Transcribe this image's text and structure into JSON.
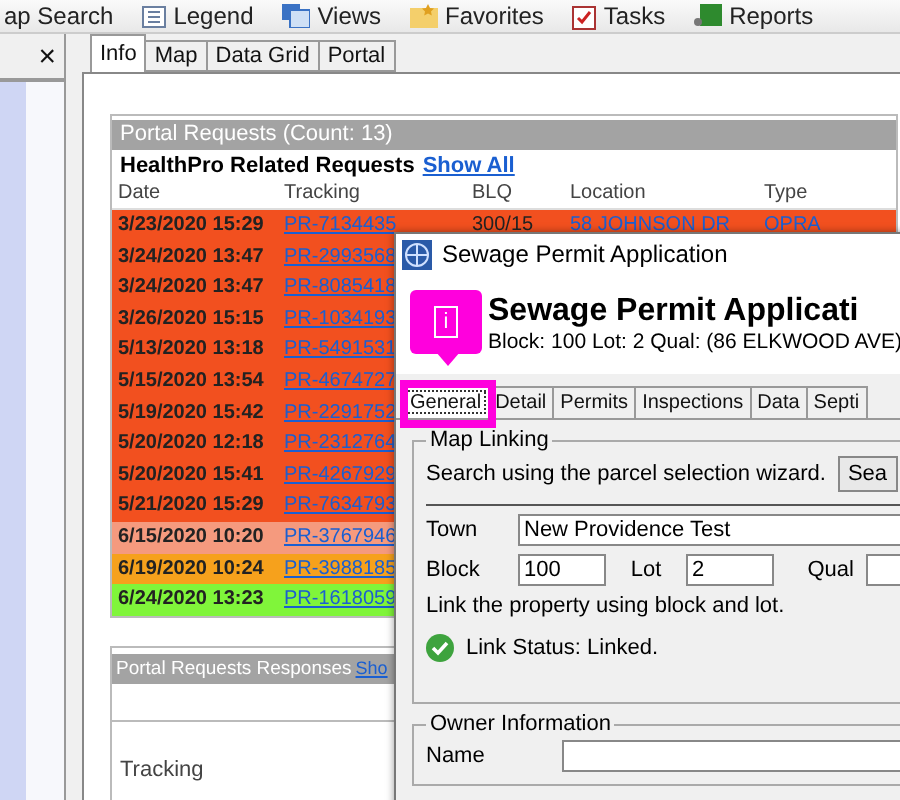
{
  "toolbar": {
    "items": [
      {
        "label": "ap Search"
      },
      {
        "label": "Legend"
      },
      {
        "label": "Views"
      },
      {
        "label": "Favorites"
      },
      {
        "label": "Tasks"
      },
      {
        "label": "Reports"
      }
    ]
  },
  "side_panel": {
    "close": "×"
  },
  "tabs": [
    {
      "label": "Info",
      "selected": true
    },
    {
      "label": "Map",
      "selected": false
    },
    {
      "label": "Data Grid",
      "selected": false
    },
    {
      "label": "Portal",
      "selected": false
    }
  ],
  "portal_requests": {
    "title": "Portal Requests (Count: 13)",
    "subtitle": "HealthPro Related Requests",
    "link": "Show All",
    "columns": [
      "Date",
      "Tracking",
      "BLQ",
      "Location",
      "Type"
    ],
    "rows": [
      {
        "date": "3/23/2020 15:29",
        "tracking": "PR-7134435",
        "blq": "300/15",
        "location": "58 JOHNSON DR",
        "type": "OPRA",
        "color": "#f2501f"
      },
      {
        "date": "3/24/2020 13:47",
        "tracking": "PR-2993568",
        "color": "#f2501f"
      },
      {
        "date": "3/24/2020 13:47",
        "tracking": "PR-8085418",
        "color": "#f2501f"
      },
      {
        "date": "3/26/2020 15:15",
        "tracking": "PR-1034193",
        "color": "#f2501f"
      },
      {
        "date": "5/13/2020 13:18",
        "tracking": "PR-5491531",
        "color": "#f2501f"
      },
      {
        "date": "5/15/2020 13:54",
        "tracking": "PR-4674727",
        "color": "#f2501f"
      },
      {
        "date": "5/19/2020 15:42",
        "tracking": "PR-2291752",
        "color": "#f2501f"
      },
      {
        "date": "5/20/2020 12:18",
        "tracking": "PR-2312764",
        "color": "#f2501f"
      },
      {
        "date": "5/20/2020 15:41",
        "tracking": "PR-4267929",
        "color": "#f2501f"
      },
      {
        "date": "5/21/2020 15:29",
        "tracking": "PR-7634793",
        "color": "#f2501f"
      },
      {
        "date": "6/15/2020 10:20",
        "tracking": "PR-3767946",
        "color": "#f59a7e"
      },
      {
        "date": "6/19/2020 10:24",
        "tracking": "PR-3988185",
        "color": "#f6a11c"
      },
      {
        "date": "6/24/2020 13:23",
        "tracking": "PR-1618059",
        "color": "#80f53a"
      }
    ]
  },
  "responses": {
    "title": "Portal Requests Responses",
    "link": "Sho",
    "label": "Tracking"
  },
  "dialog": {
    "title": "Sewage Permit Application",
    "heading": "Sewage Permit Applicati",
    "subheading": "Block: 100 Lot: 2 Qual:  (86 ELKWOOD AVE)",
    "tabs": [
      {
        "label": "General",
        "selected": true
      },
      {
        "label": "Detail",
        "selected": false
      },
      {
        "label": "Permits",
        "selected": false
      },
      {
        "label": "Inspections",
        "selected": false
      },
      {
        "label": "Data",
        "selected": false
      },
      {
        "label": "Septi",
        "selected": false
      }
    ],
    "map_linking": {
      "legend": "Map Linking",
      "hint": "Search using the parcel selection wizard.",
      "search_button": "Sea",
      "town_label": "Town",
      "town": "New Providence Test",
      "block_label": "Block",
      "block": "100",
      "lot_label": "Lot",
      "lot": "2",
      "qual_label": "Qual",
      "link_hint": "Link the property using block and lot.",
      "status": "Link Status: Linked."
    },
    "owner": {
      "legend": "Owner Information",
      "name_label": "Name"
    }
  },
  "callout": {
    "label": "i"
  }
}
